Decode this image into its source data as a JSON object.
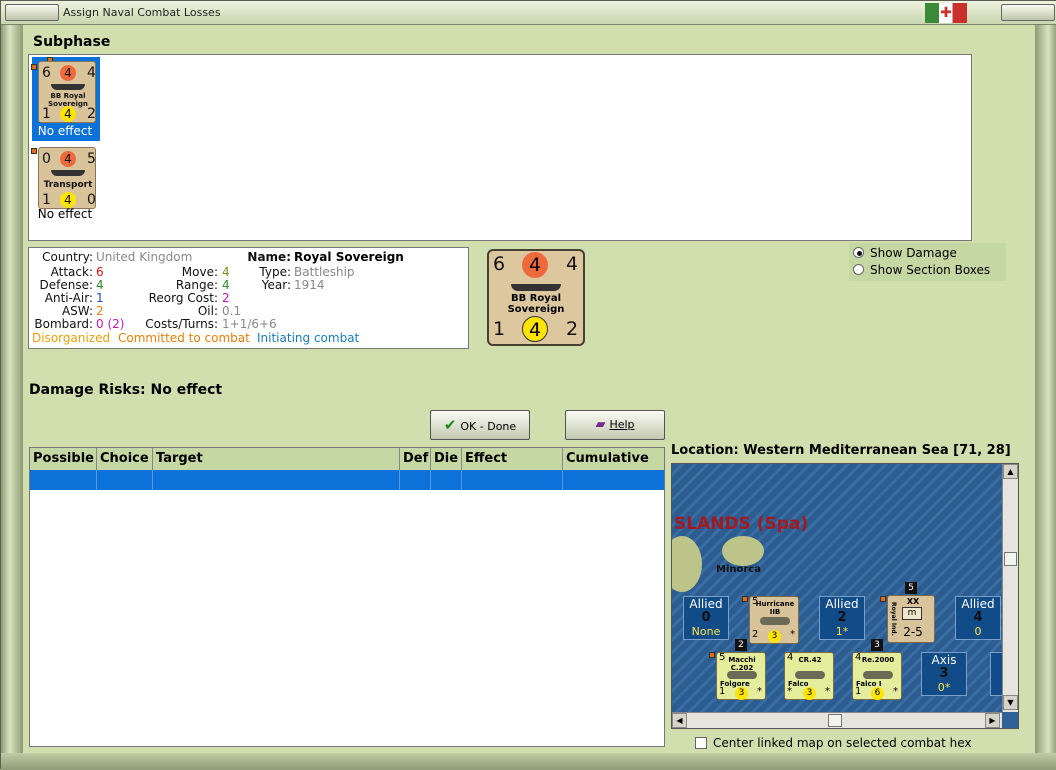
{
  "window": {
    "title": "Assign Naval Combat Losses"
  },
  "subphase": {
    "label": "Subphase"
  },
  "units": [
    {
      "name": "BB Royal Sovereign",
      "tl": "6",
      "tm": "4",
      "tr": "4",
      "bl": "1",
      "bm": "4",
      "br": "2",
      "status": "No effect",
      "selected": true
    },
    {
      "name": "Transport",
      "tl": "0",
      "tm": "4",
      "tr": "5",
      "bl": "1",
      "bm": "4",
      "br": "0",
      "status": "No effect",
      "selected": false
    }
  ],
  "info": {
    "country_label": "Country:",
    "country": "United Kingdom",
    "attack_label": "Attack:",
    "attack": "6",
    "defense_label": "Defense:",
    "defense": "4",
    "antiair_label": "Anti-Air:",
    "antiair": "1",
    "asw_label": "ASW:",
    "asw": "2",
    "bombard_label": "Bombard:",
    "bombard": "0 (2)",
    "move_label": "Move:",
    "move": "4",
    "range_label": "Range:",
    "range": "4",
    "reorg_label": "Reorg Cost:",
    "reorg": "2",
    "oil_label": "Oil:",
    "oil": "0.1",
    "costs_label": "Costs/Turns:",
    "costs": "1+1/6+6",
    "name_label": "Name:",
    "name": "Royal Sovereign",
    "type_label": "Type:",
    "type": "Battleship",
    "year_label": "Year:",
    "year": "1914",
    "status1": "Disorganized",
    "status2": "Committed to combat",
    "status3": "Initiating combat"
  },
  "bigcard": {
    "tl": "6",
    "tm": "4",
    "tr": "4",
    "name": "BB Royal Sovereign",
    "bl": "1",
    "bm": "4",
    "br": "2"
  },
  "show_options": {
    "damage": "Show Damage",
    "sections": "Show Section Boxes",
    "selected": "damage"
  },
  "damage_risks": "Damage Risks:  No effect",
  "buttons": {
    "ok": "OK - Done",
    "help": "Help"
  },
  "grid": {
    "columns": [
      "Possible",
      "Choice",
      "Target",
      "Def",
      "Die",
      "Effect",
      "Cumulative"
    ]
  },
  "location": "Location:  Western Mediterranean Sea [71, 28]",
  "map": {
    "region": "SLANDS (Spa)",
    "island": "Minorca",
    "boxes": [
      {
        "side": "Allied",
        "value": "0",
        "sub": "None"
      },
      {
        "side": "Allied",
        "value": "2",
        "sub": "1*"
      },
      {
        "side": "Allied",
        "value": "4",
        "sub": "0"
      },
      {
        "side": "Axis",
        "value": "3",
        "sub": "0*"
      }
    ],
    "air_allied": {
      "name": "Hurricane IIB",
      "tl": "5",
      "bl": "2",
      "bm": "3",
      "br": "*",
      "badge": "5"
    },
    "division": {
      "code": "XX",
      "value": "2-5",
      "label": "Royal Ind."
    },
    "air_axis": [
      {
        "name": "Macchi C.202",
        "sub": "Folgore",
        "tl": "5",
        "bl": "1",
        "bm": "3",
        "br": "*",
        "badge": "2"
      },
      {
        "name": "CR.42",
        "sub": "Falco",
        "tl": "4",
        "bl": "*",
        "bm": "3",
        "br": "*",
        "badge": ""
      },
      {
        "name": "Re.2000",
        "sub": "Falco I",
        "tl": "4",
        "bl": "1",
        "bm": "6",
        "br": "*",
        "badge": "3"
      }
    ]
  },
  "center_map": "Center linked map on selected combat hex",
  "colors": {
    "accent": "#0a72d8",
    "frame": "#d1dfae",
    "attack": "#d41414",
    "orange": "#e67e0a",
    "blue": "#1a7ab8"
  }
}
